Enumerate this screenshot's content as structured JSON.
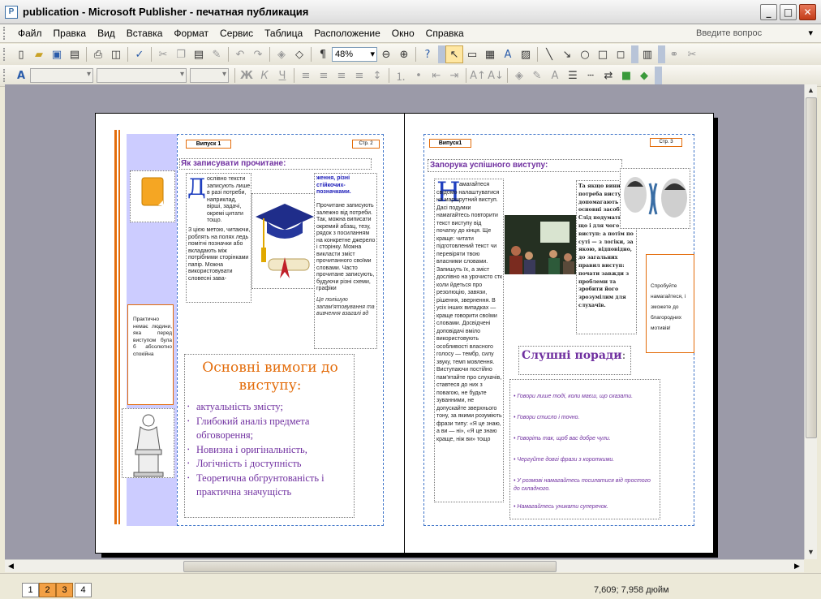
{
  "window": {
    "title": "publication - Microsoft Publisher - печатная публикация",
    "minimize": "_",
    "maximize": "□",
    "close": "✕",
    "app_icon": "P"
  },
  "menu": [
    "Файл",
    "Правка",
    "Вид",
    "Вставка",
    "Формат",
    "Сервис",
    "Таблица",
    "Расположение",
    "Окно",
    "Справка"
  ],
  "ask_placeholder": "Введите вопрос",
  "zoom": "48%",
  "pages": [
    "1",
    "2",
    "3",
    "4"
  ],
  "status_coords": "7,609; 7,958 дюйм",
  "left_page": {
    "issue": "Випуск 1",
    "page_no": "Стр. 2",
    "heading": "Як записувати прочитане:",
    "col1_dropcap": "Д",
    "col1_text": "ослівно тексти записують лише в разі потреби, наприклад, вірші, задачі, окремі цитати тощо.",
    "col1_text2": "З цією метою, читаючи, роблять на полях ледь помітні позначки або вкладають між потрібними сторінками папір. Можна використовувати словесні зава-",
    "col3_text1": "ження, різні стійкочих-позначками.",
    "col3_text2": "Прочитане записують залежно від потреби. Так, можна виписати окремий абзац, тезу, рядок з посиланням на конкретне джерело і сторінку. Можна викласти зміст прочитанного своїми словами. Часто прочитане записують, будуючи різні схеми, графіки",
    "col3_note": "Це полішую запам'ятовування та вивчення взагалі вд",
    "sidebar_text": "Практично немає людини, яка перед виступом була б абсолютно спокійна",
    "req_title": "Основні вимоги до виступу:",
    "req_items": [
      "актуальність змісту;",
      "Глибокий аналіз предмета обговорення;",
      "Новизна і оригінальність,",
      "Логічність і доступність",
      "Теоретична обгрунтованість і практична значущість"
    ]
  },
  "right_page": {
    "issue": "Випуск1",
    "page_no": "Стр. 3",
    "heading": "Запорука успішного виступу:",
    "dropcap": "Н",
    "col1_text": "амагайтеся свідомо налаштуватися на маршрутний виступ. Дасі подумки намагайтесь повторити текст виступу від початку до кінця. Ще краще: читати підготовлений текст чи перевіряти твою власними словами. Запишуть їх, а зміст дослівно на урочисто стк коли йдеться про резолюцію, завязи, рішення, звернення. В усіх інших випадках — краще говорити своїми словами. Досвідчені доповідачі вміло використовують особливості власного голосу — тембр, силу звуку, темп мовлення. Виступаючи постійно пам'ятайте про слухачів, ставтеся до них з повагою, не будьте зуванними, не допускайте зверхнього тону, за якими розуміють фрази типу: «Я це знаю, а ви — ні», «Я це знаю краще, ніж ви» тощо",
    "col3_text": "Та якщо виникла потреба виступу, допомагають та основні засоби. Слід подумати, за що і для чого виступ: а потім по суті — з логіки, за якою, відповідно, до загальних правил виступ: почати завжди з проблеми та зробити його зрозумілим для слухачів.",
    "callout": "Спробуйте намагайтеся, і зможете до благородних мотивів!",
    "tips_title": "Слушні поради",
    "tips_colon": ":",
    "tips": [
      "Говори лише тоді, коли маєш, що сказати.",
      "Говори стисло і точно.",
      "Говоріть так, щоб вас добре чули.",
      "Чергуйте довгі фрази з короткими.",
      "У розмові намагайтесь посилатися від простого до складного.",
      "Намагайтесь уникати суперечок."
    ]
  },
  "colors": {
    "orange": "#e36c0a",
    "purple": "#7030a0",
    "blue": "#0000cc",
    "sidebar": "#ccccff"
  }
}
